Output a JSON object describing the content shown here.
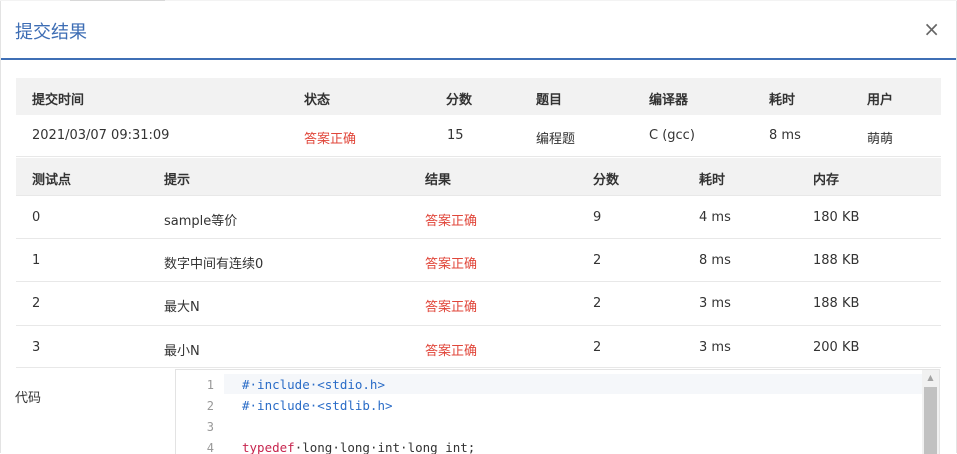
{
  "modal": {
    "title": "提交结果",
    "close_glyph": "×"
  },
  "summary": {
    "headers": [
      "提交时间",
      "状态",
      "分数",
      "题目",
      "编译器",
      "耗时",
      "用户"
    ],
    "row": [
      "2021/03/07 09:31:09",
      "答案正确",
      "15",
      "编程题",
      "C (gcc)",
      "8 ms",
      "萌萌"
    ]
  },
  "cases": {
    "headers": [
      "测试点",
      "提示",
      "结果",
      "分数",
      "耗时",
      "内存"
    ],
    "rows": [
      [
        "0",
        "sample等价",
        "答案正确",
        "9",
        "4 ms",
        "180 KB"
      ],
      [
        "1",
        "数字中间有连续0",
        "答案正确",
        "2",
        "8 ms",
        "188 KB"
      ],
      [
        "2",
        "最大N",
        "答案正确",
        "2",
        "3 ms",
        "188 KB"
      ],
      [
        "3",
        "最小N",
        "答案正确",
        "2",
        "3 ms",
        "200 KB"
      ]
    ]
  },
  "code": {
    "label": "代码",
    "line_numbers": [
      "1",
      "2",
      "3",
      "4"
    ],
    "lines": [
      [
        {
          "t": "#·include·<stdio.h>",
          "c": "pp"
        }
      ],
      [
        {
          "t": "#·include·<stdlib.h>",
          "c": "pp"
        }
      ],
      [],
      [
        {
          "t": "typedef",
          "c": "kw"
        },
        {
          "t": "·long·long·int·long_int;",
          "c": "plain"
        }
      ]
    ]
  },
  "colors": {
    "accent": "#3d6db4",
    "accepted": "#e0463a",
    "header_bg": "#f2f2f2"
  },
  "icons": {
    "close": "close-icon",
    "scroll_up": "scroll-up-arrow-icon"
  }
}
